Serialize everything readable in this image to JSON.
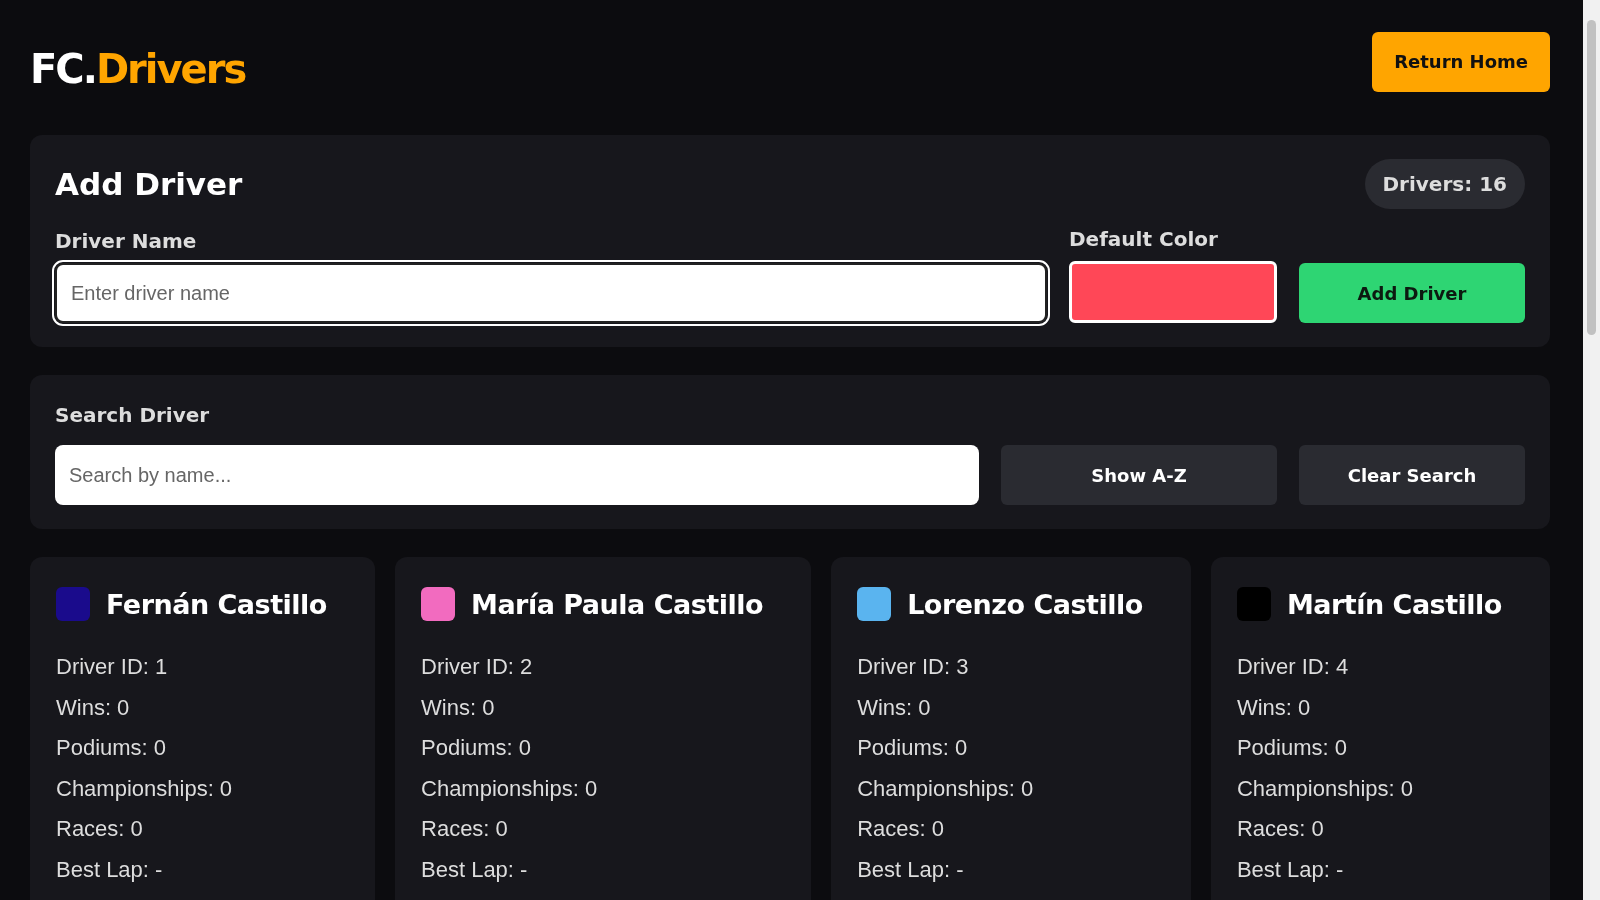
{
  "logo": {
    "prefix": "FC.",
    "suffix": "Drivers"
  },
  "return_button": "Return Home",
  "add_panel": {
    "title": "Add Driver",
    "count_badge": "Drivers: 16",
    "name_label": "Driver Name",
    "name_placeholder": "Enter driver name",
    "color_label": "Default Color",
    "color": "#ff4757",
    "submit": "Add Driver"
  },
  "search_panel": {
    "label": "Search Driver",
    "placeholder": "Search by name...",
    "sort_button": "Show A-Z",
    "clear_button": "Clear Search"
  },
  "drivers": [
    {
      "name": "Fernán Castillo",
      "color": "#1a0b8c",
      "stats": [
        "Driver ID: 1",
        "Wins: 0",
        "Podiums: 0",
        "Championships: 0",
        "Races: 0",
        "Best Lap: -"
      ]
    },
    {
      "name": "María Paula Castillo",
      "color": "#f26bbf",
      "stats": [
        "Driver ID: 2",
        "Wins: 0",
        "Podiums: 0",
        "Championships: 0",
        "Races: 0",
        "Best Lap: -"
      ]
    },
    {
      "name": "Lorenzo Castillo",
      "color": "#5ab4ef",
      "stats": [
        "Driver ID: 3",
        "Wins: 0",
        "Podiums: 0",
        "Championships: 0",
        "Races: 0",
        "Best Lap: -"
      ]
    },
    {
      "name": "Martín Castillo",
      "color": "#000000",
      "stats": [
        "Driver ID: 4",
        "Wins: 0",
        "Podiums: 0",
        "Championships: 0",
        "Races: 0",
        "Best Lap: -"
      ]
    }
  ]
}
